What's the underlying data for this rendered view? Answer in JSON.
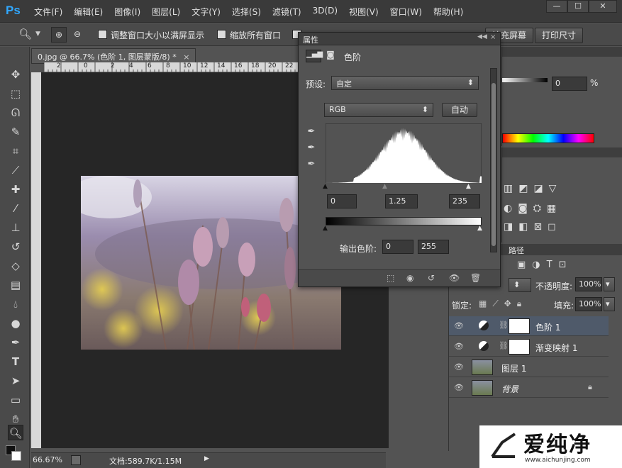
{
  "app": {
    "logo": "Ps"
  },
  "menu": [
    "文件(F)",
    "编辑(E)",
    "图像(I)",
    "图层(L)",
    "文字(Y)",
    "选择(S)",
    "滤镜(T)",
    "3D(D)",
    "视图(V)",
    "窗口(W)",
    "帮助(H)"
  ],
  "options": {
    "resize_window_label": "调整窗口大小以满屏显示",
    "zoom_all_label": "缩放所有窗口",
    "fill_screen_label": "填充屏幕",
    "print_size_label": "打印尺寸"
  },
  "document": {
    "tab_title": "0.jpg @ 66.7% (色阶 1, 图层蒙版/8) *",
    "ruler_ticks": [
      "2",
      "0",
      "2",
      "4",
      "6",
      "8",
      "10",
      "12",
      "14",
      "16",
      "18",
      "20",
      "22"
    ],
    "zoom": "66.67%",
    "doc_size": "文档:589.7K/1.15M"
  },
  "properties": {
    "tab_label": "属性",
    "title": "色阶",
    "preset_label": "预设:",
    "preset_value": "自定",
    "channel_value": "RGB",
    "auto_label": "自动",
    "input_black": "0",
    "input_gamma": "1.25",
    "input_white": "235",
    "output_label": "输出色阶:",
    "output_black": "0",
    "output_white": "255"
  },
  "color_panel": {
    "percent_value": "0",
    "percent_unit": "%"
  },
  "layers": {
    "paths_tab": "路径",
    "opacity_label": "不透明度:",
    "opacity_value": "100%",
    "lock_label": "锁定:",
    "fill_label": "填充:",
    "fill_value": "100%",
    "items": [
      {
        "name": "色阶 1",
        "type": "adjustment",
        "selected": true
      },
      {
        "name": "渐变映射 1",
        "type": "adjustment",
        "selected": false
      },
      {
        "name": "图层 1",
        "type": "image",
        "selected": false
      },
      {
        "name": "背景",
        "type": "background",
        "selected": false
      }
    ]
  },
  "watermark": {
    "brand": "爱纯净",
    "url": "www.aichunjing.com"
  },
  "colors": {
    "accent": "#31a8ff",
    "panel": "#535353",
    "dark": "#262626",
    "selected_row": "#4f5a6a"
  }
}
